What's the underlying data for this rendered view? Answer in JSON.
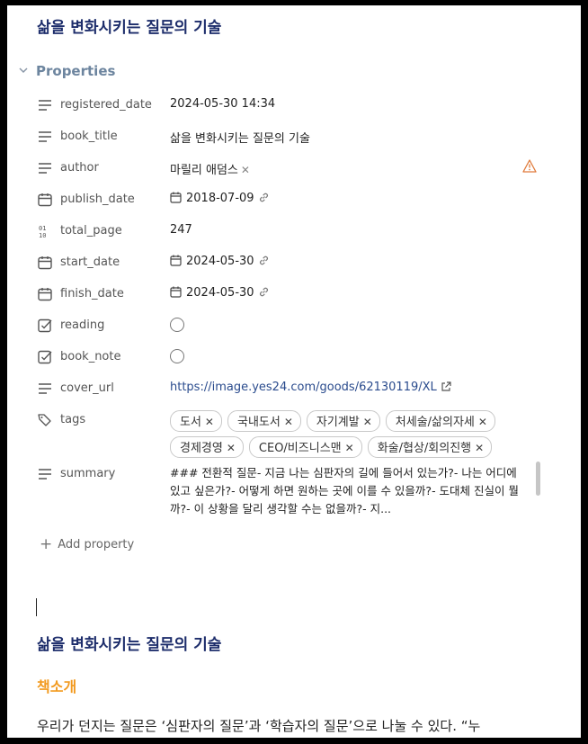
{
  "note": {
    "title": "삶을 변화시키는 질문의 기술",
    "properties_label": "Properties",
    "add_property_label": "Add property"
  },
  "properties": {
    "registered_date": {
      "key": "registered_date",
      "value": "2024-05-30 14:34"
    },
    "book_title": {
      "key": "book_title",
      "value": "삶을 변화시키는 질문의 기술"
    },
    "author": {
      "key": "author",
      "value": "마릴리 애덤스",
      "warning_icon": "warning-icon"
    },
    "publish_date": {
      "key": "publish_date",
      "value": "2018-07-09"
    },
    "total_page": {
      "key": "total_page",
      "value": "247"
    },
    "start_date": {
      "key": "start_date",
      "value": "2024-05-30"
    },
    "finish_date": {
      "key": "finish_date",
      "value": "2024-05-30"
    },
    "reading": {
      "key": "reading",
      "checked": false
    },
    "book_note": {
      "key": "book_note",
      "checked": false
    },
    "cover_url": {
      "key": "cover_url",
      "value": "https://image.yes24.com/goods/62130119/XL"
    },
    "tags": {
      "key": "tags",
      "values": [
        "도서",
        "국내도서",
        "자기계발",
        "처세술/삶의자세",
        "경제경영",
        "CEO/비즈니스맨",
        "화술/협상/회의진행"
      ]
    },
    "summary": {
      "key": "summary",
      "value": "### 전환적 질문- 지금 나는 심판자의 길에 들어서 있는가?- 나는 어디에 있고 싶은가?- 어떻게 하면 원하는 곳에 이를 수 있을까?- 도대체 진실이 뭘까?- 이 상황을 달리 생각할 수는 없을까?- 지..."
    }
  },
  "body": {
    "heading1": "삶을 변화시키는 질문의 기술",
    "heading2": "책소개",
    "paragraph": "우리가 던지는 질문은 ‘심판자의 질문’과 ‘학습자의 질문’으로 나눌 수 있다. “누"
  },
  "colors": {
    "title": "#1d2d6b",
    "properties_label": "#6d859f",
    "heading2": "#f29a1f",
    "link": "#2a4b8d",
    "warning": "#e07b3c"
  }
}
